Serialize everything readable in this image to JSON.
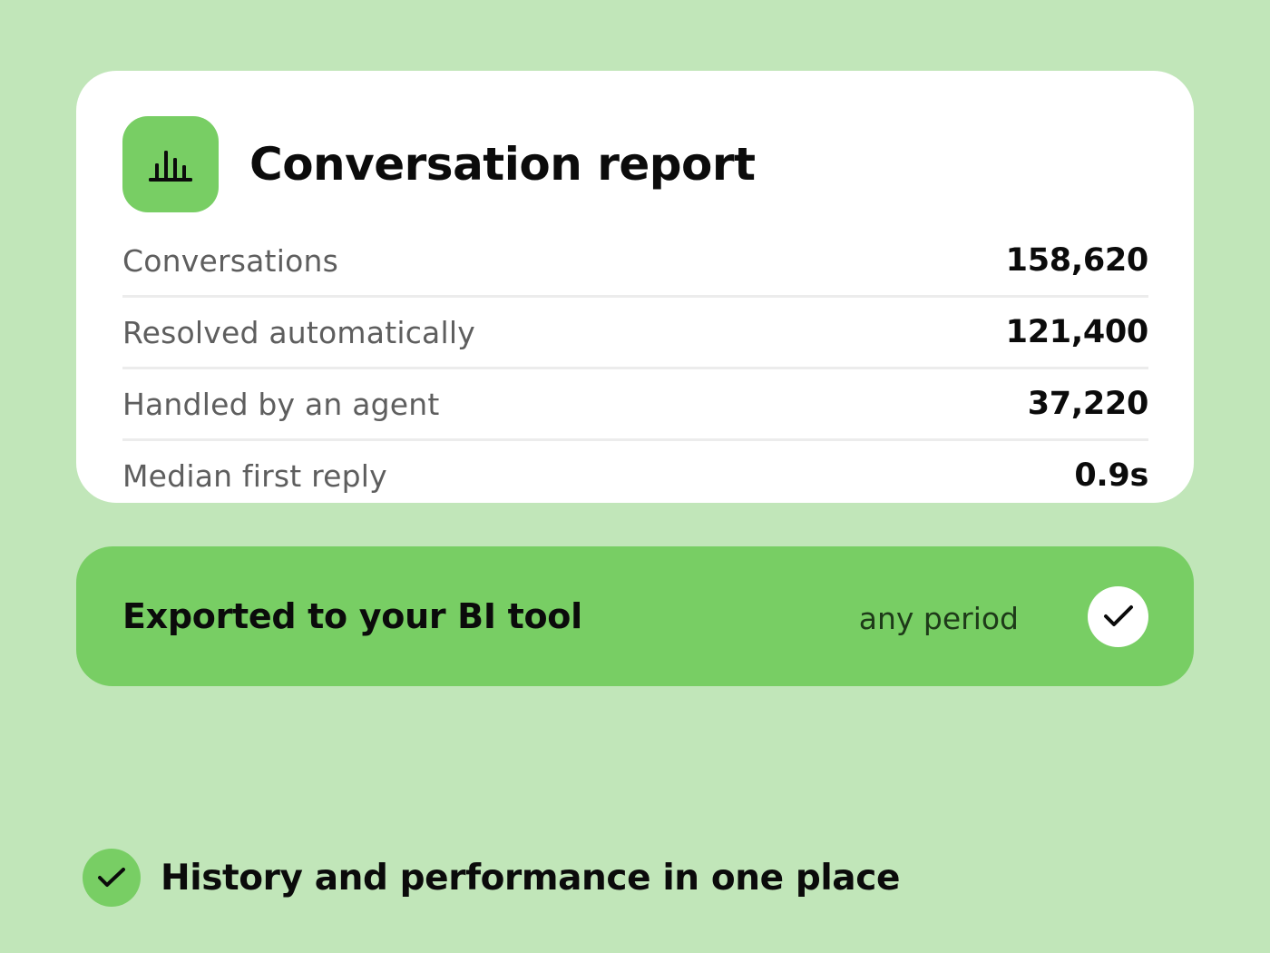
{
  "report": {
    "title": "Conversation report",
    "icon": "bar-chart-icon",
    "stats": [
      {
        "label": "Conversations",
        "value": "158,620"
      },
      {
        "label": "Resolved automatically",
        "value": "121,400"
      },
      {
        "label": "Handled by an agent",
        "value": "37,220"
      },
      {
        "label": "Median first reply",
        "value": "0.9s"
      }
    ]
  },
  "export": {
    "label": "Exported to your BI tool",
    "period": "any period",
    "icon": "check-icon"
  },
  "feature": {
    "icon": "check-icon",
    "text": "History and performance in one place"
  },
  "colors": {
    "background": "#c1e6b9",
    "accent": "#78ce64",
    "card": "#ffffff",
    "text": "#0b0b0b",
    "muted_text": "#5e5e5e"
  }
}
